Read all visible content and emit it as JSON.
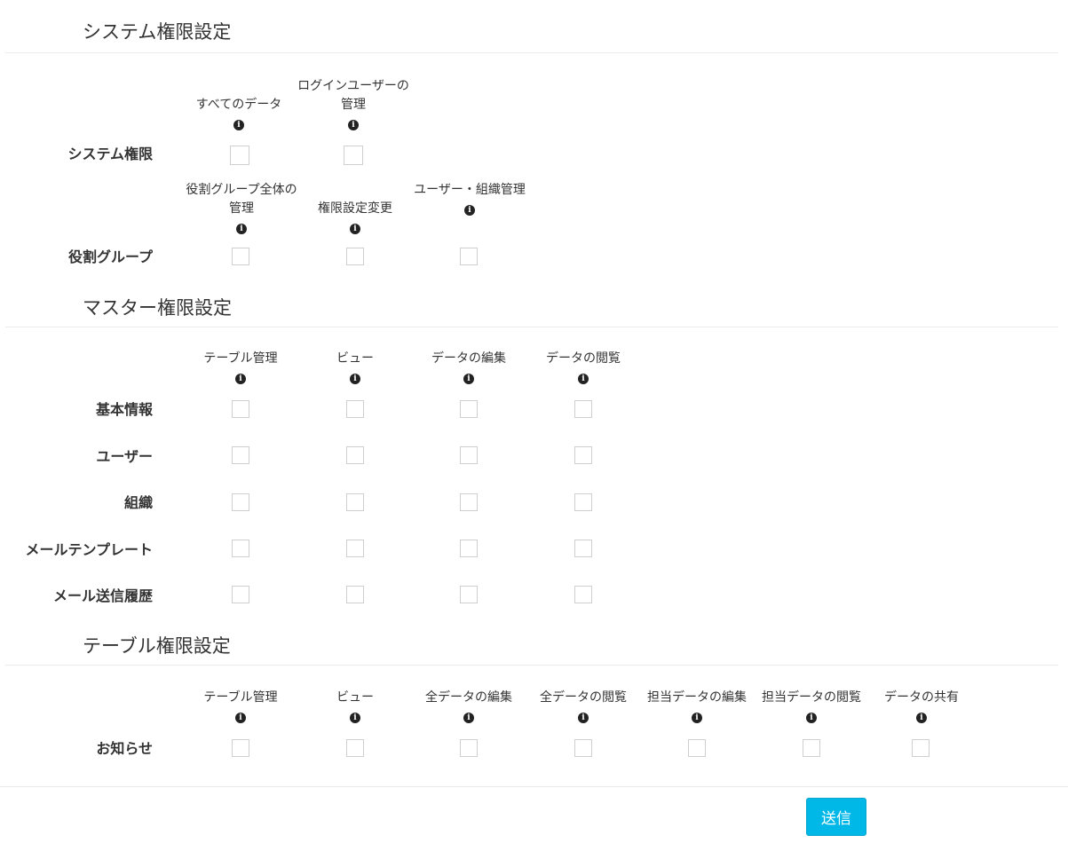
{
  "system": {
    "title": "システム権限設定",
    "rows": [
      {
        "label": "システム権限",
        "columns": [
          "すべてのデータ",
          "ログインユーザーの管理"
        ]
      },
      {
        "label": "役割グループ",
        "columns": [
          "役割グループ全体の管理",
          "権限設定変更",
          "ユーザー・組織管理"
        ]
      }
    ]
  },
  "master": {
    "title": "マスター権限設定",
    "columns": [
      "テーブル管理",
      "ビュー",
      "データの編集",
      "データの閲覧"
    ],
    "rows": [
      "基本情報",
      "ユーザー",
      "組織",
      "メールテンプレート",
      "メール送信履歴"
    ]
  },
  "table": {
    "title": "テーブル権限設定",
    "columns": [
      "テーブル管理",
      "ビュー",
      "全データの編集",
      "全データの閲覧",
      "担当データの編集",
      "担当データの閲覧",
      "データの共有"
    ],
    "rows": [
      "お知らせ"
    ]
  },
  "icons": {
    "info": "info-circle-icon"
  },
  "submit_label": "送信",
  "colors": {
    "accent": "#00b8e8",
    "border": "#cfcfcf",
    "divider": "#ececec"
  }
}
